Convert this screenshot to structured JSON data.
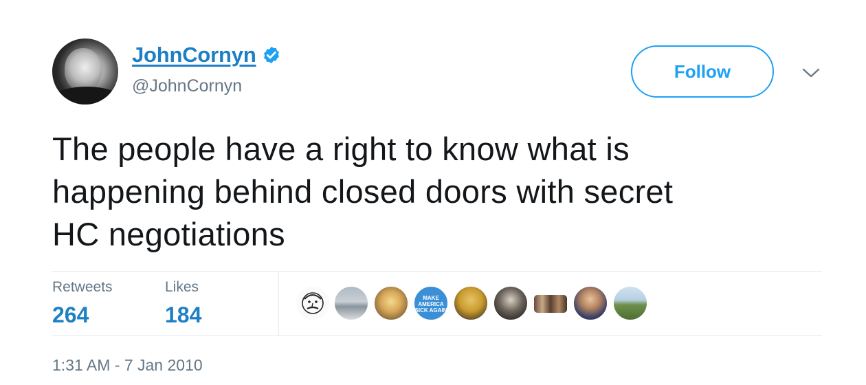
{
  "author": {
    "display_name": "JohnCornyn",
    "handle": "@JohnCornyn",
    "verified": true,
    "verified_color": "#1da1f2"
  },
  "actions": {
    "follow_label": "Follow",
    "menu_icon": "chevron-down-icon"
  },
  "tweet": {
    "text_lines": [
      "The people have a right to know what is",
      "happening behind closed doors with secret",
      "HC negotiations"
    ],
    "timestamp": "1:31 AM - 7 Jan 2010"
  },
  "stats": {
    "retweets": {
      "label": "Retweets",
      "count": "264"
    },
    "likes": {
      "label": "Likes",
      "count": "184"
    }
  },
  "likers": {
    "avatar_count": 9,
    "make_america_text": "MAKE AMERICA SICK AGAIN"
  },
  "colors": {
    "accent": "#1da1f2",
    "link": "#1d7fc4",
    "secondary_text": "#657786",
    "divider": "#e1e8ed"
  }
}
